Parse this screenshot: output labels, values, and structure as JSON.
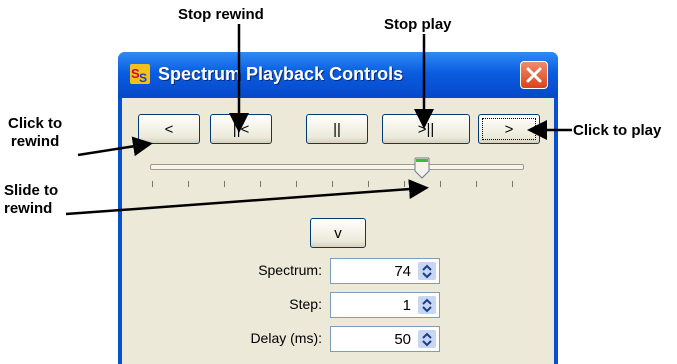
{
  "annotations": {
    "stop_rewind": "Stop rewind",
    "stop_play": "Stop play",
    "click_to_rewind": "Click  to\nrewind",
    "click_to_play": "Click to play",
    "slide_to_rewind": "Slide to\nrewind"
  },
  "window": {
    "title": "Spectrum Playback Controls",
    "icon_text": "SS",
    "buttons": {
      "rewind": "<",
      "stop_rewind": "||<",
      "pause": "||",
      "stop_play": ">||",
      "play": ">",
      "down": "v"
    },
    "slider": {
      "value_fraction": 0.73
    },
    "fields": {
      "spectrum": {
        "label": "Spectrum:",
        "value": "74"
      },
      "step": {
        "label": "Step:",
        "value": "1"
      },
      "delay": {
        "label": "Delay (ms):",
        "value": "50"
      }
    },
    "colors": {
      "title_bar": "#0a5de0",
      "client": "#ece9d8",
      "close": "#d9421c"
    }
  }
}
